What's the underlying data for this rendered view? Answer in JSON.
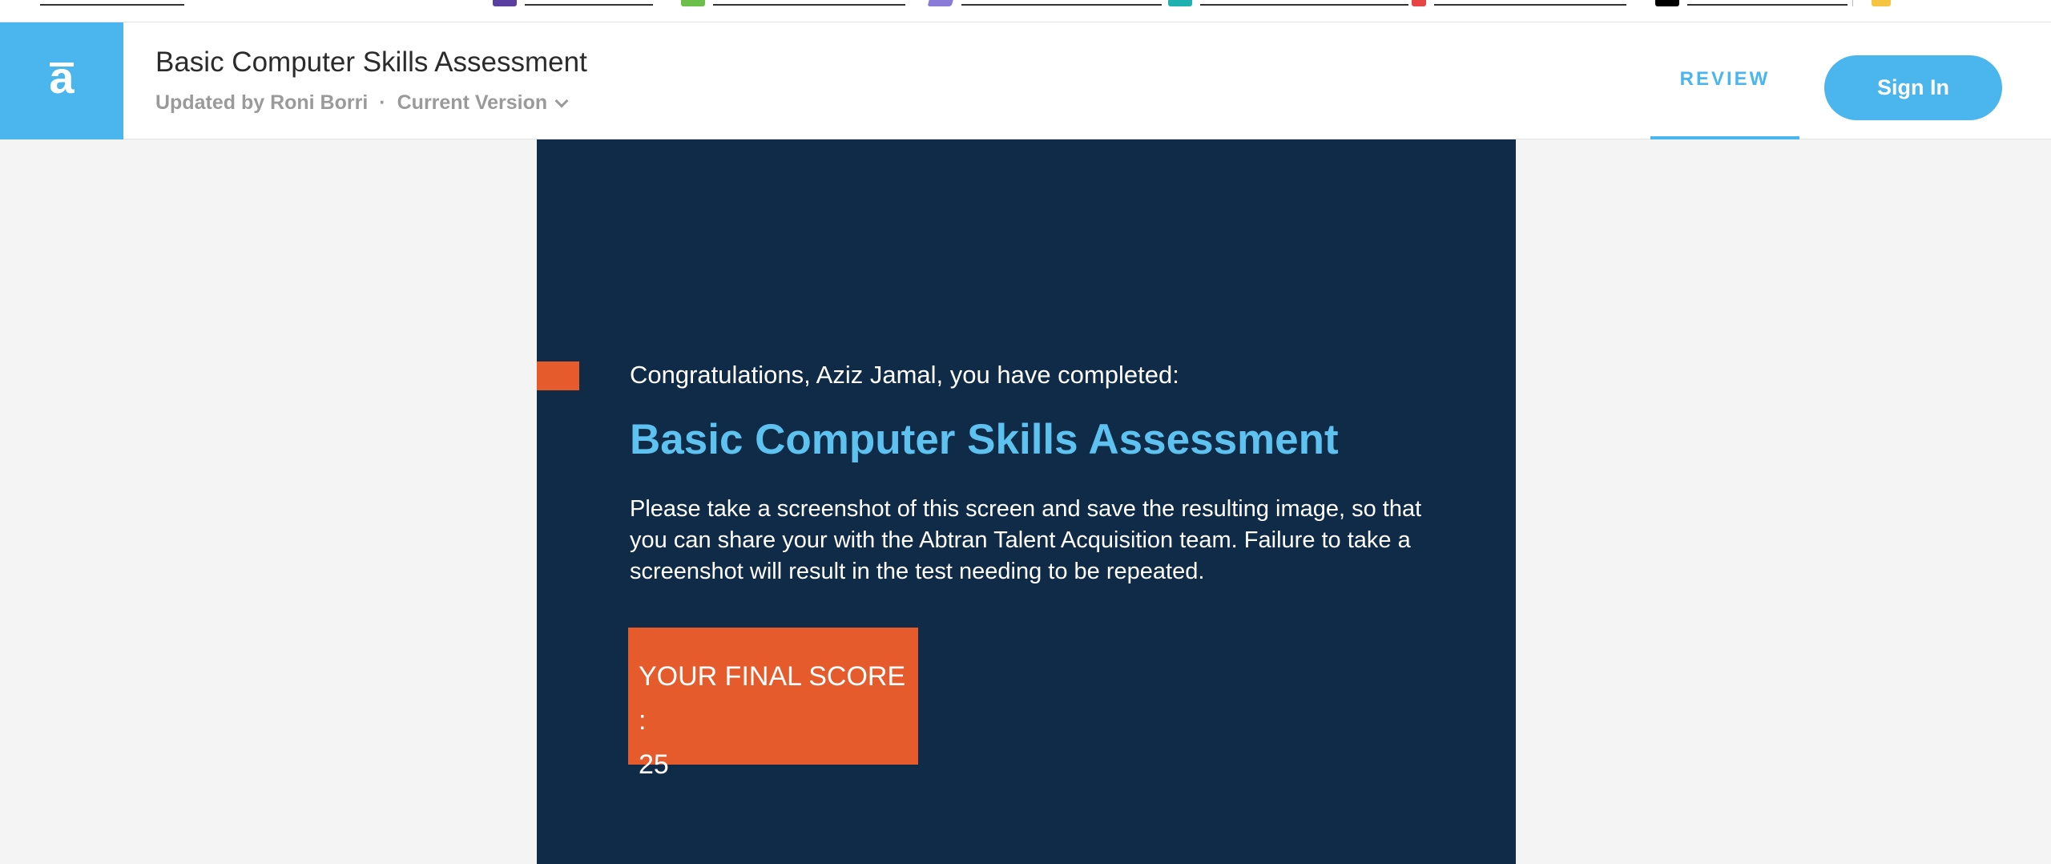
{
  "header": {
    "title": "Basic Computer Skills Assessment",
    "updated_by": "Updated by Roni Borri",
    "separator": "·",
    "version_label": "Current Version",
    "review_label": "REVIEW",
    "signin_label": "Sign In",
    "logo_glyph": "a"
  },
  "result": {
    "congrats": "Congratulations, Aziz Jamal, you have completed:",
    "headline": "Basic Computer Skills Assessment",
    "instructions": "Please take a screenshot of this screen and save the resulting image, so that you can share your with the Abtran Talent Acquisition team. Failure to take a screenshot will result in the test needing to be repeated.",
    "score_label": "YOUR FINAL SCORE :",
    "score_value": "25"
  },
  "colors": {
    "brand_blue": "#4bb5ee",
    "card_navy": "#0f2b47",
    "accent_orange": "#e65b2c",
    "headline_blue": "#5ec2f1"
  }
}
